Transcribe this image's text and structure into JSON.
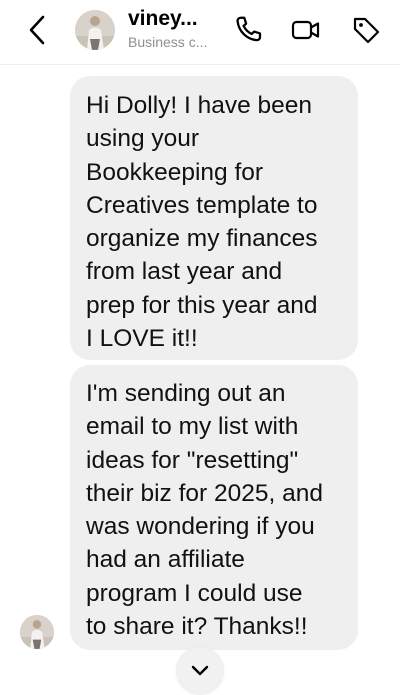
{
  "header": {
    "name": "viney...",
    "subtitle": "Business c...",
    "icons": {
      "back": "chevron-left-icon",
      "call": "phone-icon",
      "video": "video-camera-icon",
      "label": "tag-icon"
    }
  },
  "messages": [
    {
      "text": "Hi Dolly! I have been\nusing your\nBookkeeping for\nCreatives template to\norganize my finances\nfrom last year and\nprep for this year and\nI LOVE it!!"
    },
    {
      "text": "I'm sending out an\nemail to my list with\nideas for \"resetting\"\ntheir biz for 2025, and\nwas wondering if you\nhad an affiliate\nprogram I could use\nto share it? Thanks!!"
    }
  ],
  "colors": {
    "bubble_bg": "#efeff0",
    "text": "#111111",
    "subtitle": "#8e8e93"
  }
}
